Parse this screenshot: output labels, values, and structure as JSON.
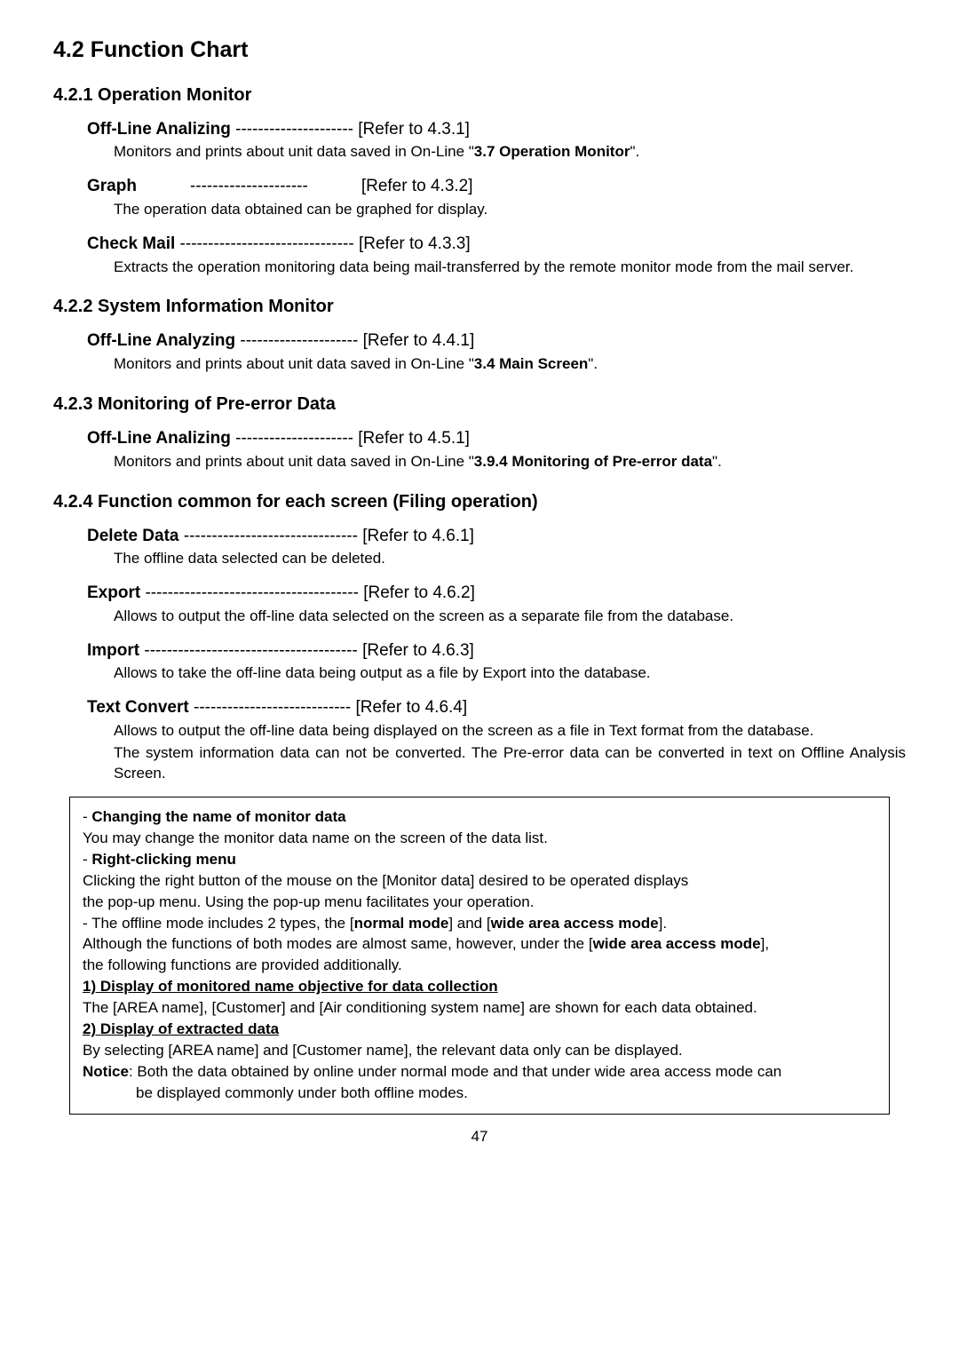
{
  "title": "4.2 Function Chart",
  "sections": [
    {
      "heading": "4.2.1 Operation Monitor",
      "entries": [
        {
          "name": "Off-Line Analizing",
          "dashes": " --------------------- ",
          "ref": "[Refer to 4.3.1]",
          "desc": [
            "Monitors and prints about unit data saved in On-Line \"",
            "3.7 Operation Monitor",
            "\"."
          ]
        },
        {
          "name": "Graph",
          "spacer": true,
          "dashes": "---------------------",
          "ref": "[Refer to 4.3.2]",
          "desc": [
            "The operation data obtained can be graphed for display."
          ]
        },
        {
          "name": "Check Mail",
          "dashes": " ------------------------------- ",
          "ref": "[Refer to 4.3.3]",
          "desc": [
            "Extracts the operation monitoring data being mail-transferred by the remote monitor mode from the mail server."
          ]
        }
      ]
    },
    {
      "heading": "4.2.2 System Information Monitor",
      "entries": [
        {
          "name": "Off-Line Analyzing",
          "dashes": " --------------------- ",
          "ref": "[Refer to 4.4.1]",
          "desc": [
            "Monitors and prints about unit data saved in On-Line \"",
            "3.4 Main Screen",
            "\"."
          ]
        }
      ]
    },
    {
      "heading": "4.2.3 Monitoring of Pre-error Data",
      "entries": [
        {
          "name": "Off-Line Analizing",
          "dashes": " --------------------- ",
          "ref": "[Refer to 4.5.1]",
          "desc": [
            "Monitors and prints about unit data saved in On-Line \"",
            "3.9.4 Monitoring of Pre-error data",
            "\"."
          ]
        }
      ]
    },
    {
      "heading": "4.2.4 Function common for each screen (Filing operation)",
      "entries": [
        {
          "name": "Delete Data",
          "dashes": " ------------------------------- ",
          "ref": "[Refer to 4.6.1]",
          "desc": [
            "The offline data selected can be deleted."
          ]
        },
        {
          "name": "Export",
          "dashes": " -------------------------------------- ",
          "ref": "[Refer to 4.6.2]",
          "desc": [
            "Allows to output the off-line data selected on the screen as a separate file from the database."
          ]
        },
        {
          "name": " Import",
          "dashes": " -------------------------------------- ",
          "ref": "[Refer to 4.6.3]",
          "desc": [
            "Allows to take the off-line data being output as a file by Export into the database."
          ]
        },
        {
          "name": "Text Convert",
          "dashes": " ---------------------------- ",
          "ref": "[Refer to 4.6.4]",
          "desc_multi": [
            "Allows to output the off-line data being displayed on the screen as a file in Text format from the database.",
            "The system information data can not be converted. The Pre-error data can be converted in text on Offline Analysis Screen."
          ]
        }
      ]
    }
  ],
  "box": {
    "l1a": "- ",
    "l1b": "Changing the name of monitor data",
    "l2": "You may change the monitor data name on the screen of the data list.",
    "l3a": "- ",
    "l3b": "Right-clicking menu",
    "l4": "Clicking the right button of the mouse on the [Monitor data] desired to be operated displays",
    "l5": "the pop-up menu. Using the pop-up menu facilitates your operation.",
    "l6a": "- The offline mode includes 2 types, the [",
    "l6b": "normal mode",
    "l6c": "] and [",
    "l6d": "wide area access mode",
    "l6e": "].",
    "l7a": "Although the functions of both modes are almost same, however, under the [",
    "l7b": "wide area access mode",
    "l7c": "],",
    "l8": "the following functions are provided additionally.",
    "l9": "1) Display of monitored name objective for data collection",
    "l10": "The [AREA name], [Customer] and [Air conditioning system name] are shown for each data obtained.",
    "l11": "2) Display of extracted data",
    "l12": "By selecting [AREA name] and [Customer name], the relevant data only can be displayed.",
    "l13a": "Notice",
    "l13b": ": Both the data obtained by online under normal mode and that under wide area access mode can",
    "l14": "be displayed commonly under both offline modes."
  },
  "page": "47"
}
